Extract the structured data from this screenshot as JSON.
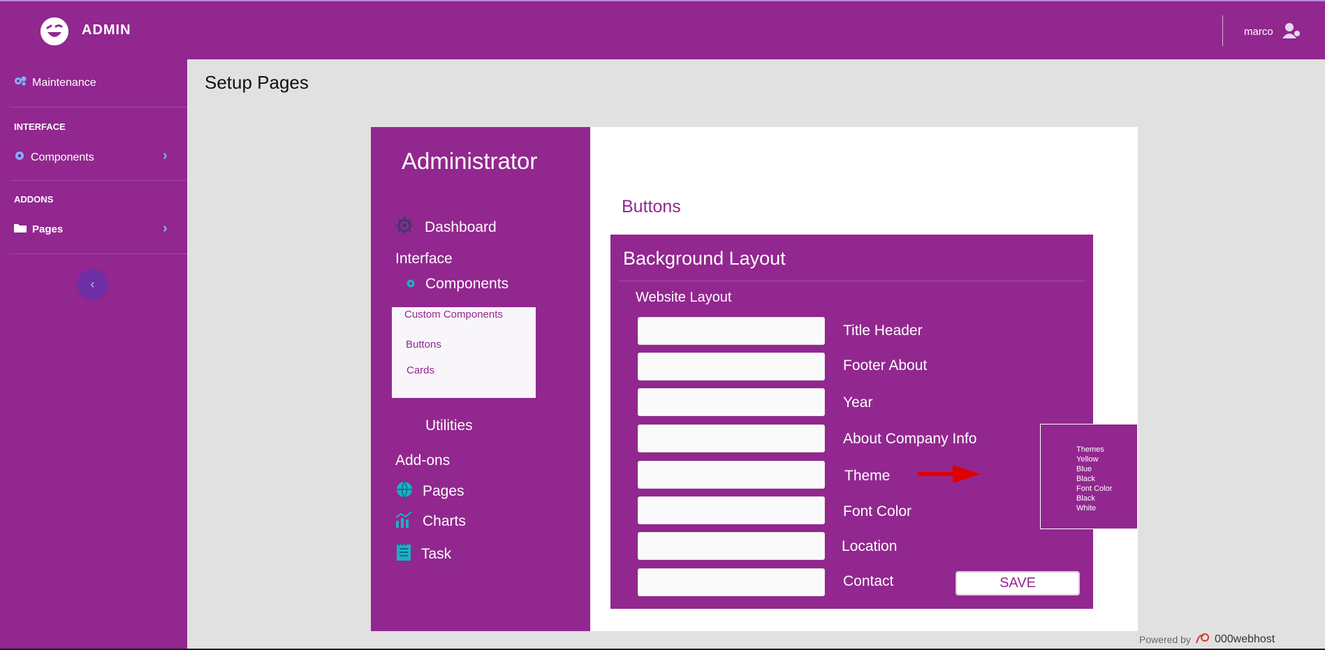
{
  "header": {
    "brand": "ADMIN",
    "user": "marco"
  },
  "sidebar": {
    "maintenance": "Maintenance",
    "section_interface": "INTERFACE",
    "components": "Components",
    "section_addons": "ADDONS",
    "pages": "Pages",
    "collapse_glyph": "‹"
  },
  "page": {
    "title": "Setup Pages"
  },
  "admin_panel": {
    "title": "Administrator",
    "dashboard": "Dashboard",
    "interface": "Interface",
    "components": "Components",
    "submenu": {
      "custom_components": "Custom Components",
      "buttons": "Buttons",
      "cards": "Cards"
    },
    "utilities": "Utilities",
    "addons": "Add-ons",
    "pages": "Pages",
    "charts": "Charts",
    "task": "Task"
  },
  "content": {
    "section_title": "Buttons",
    "card_title": "Background Layout",
    "sub_title": "Website Layout",
    "fields": [
      "Title Header",
      "Footer About",
      "Year",
      "About Company Info",
      "Theme",
      "Font Color",
      "Location",
      "Contact"
    ],
    "save_label": "SAVE"
  },
  "themes_box": [
    "Themes",
    "Yellow",
    "Blue",
    "Black",
    "Font Color",
    "Black",
    "White"
  ],
  "footer": {
    "powered": "Powered by",
    "host": "000webhost"
  },
  "colors": {
    "brand_purple": "#92278f",
    "background": "#e1e1e1",
    "accent_arrow": "#e00000"
  }
}
